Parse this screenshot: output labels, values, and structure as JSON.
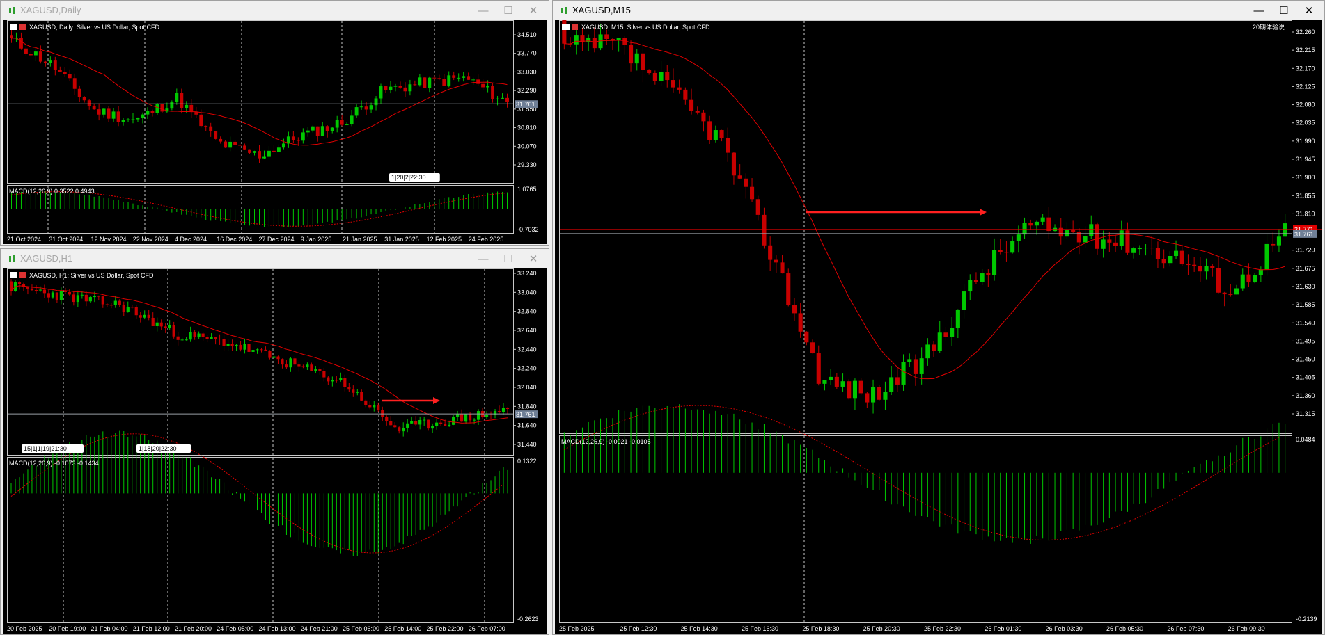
{
  "windows": {
    "daily": {
      "title": "XAGUSD,Daily",
      "header": "XAGUSD, Daily:  Silver vs US Dollar, Spot CFD",
      "macd_label": "MACD(12,26,9) 0.3522 0.4943",
      "price_labels": [
        "34.510",
        "33.770",
        "33.030",
        "32.290",
        "31.550",
        "30.810",
        "30.070",
        "29.330"
      ],
      "current_price": "31.761",
      "macd_labels": [
        "1.0765",
        "-0.7032"
      ],
      "time_labels": [
        "21 Oct 2024",
        "31 Oct 2024",
        "12 Nov 2024",
        "22 Nov 2024",
        "4 Dec 2024",
        "16 Dec 2024",
        "27 Dec 2024",
        "9 Jan 2025",
        "21 Jan 2025",
        "31 Jan 2025",
        "12 Feb 2025",
        "24 Feb 2025"
      ],
      "countdown": "1|20|2|22:30"
    },
    "h1": {
      "title": "XAGUSD,H1",
      "header": "XAGUSD, H1:  Silver vs US Dollar, Spot CFD",
      "macd_label": "MACD(12,26,9) -0.1073 -0.1434",
      "price_labels": [
        "33.240",
        "33.040",
        "32.840",
        "32.640",
        "32.440",
        "32.240",
        "32.040",
        "31.840",
        "31.640",
        "31.440"
      ],
      "current_price": "31.761",
      "macd_labels": [
        "0.1322",
        "-0.2623"
      ],
      "time_labels": [
        "20 Feb 2025",
        "20 Feb 19:00",
        "21 Feb 04:00",
        "21 Feb 12:00",
        "21 Feb 20:00",
        "24 Feb 05:00",
        "24 Feb 13:00",
        "24 Feb 21:00",
        "25 Feb 06:00",
        "25 Feb 14:00",
        "25 Feb 22:00",
        "26 Feb 07:00"
      ],
      "countdown_left": "15|1|1|19|21:30",
      "countdown_mid": "1|18|20|22:30"
    },
    "m15": {
      "title": "XAGUSD,M15",
      "header": "XAGUSD, M15:  Silver vs US Dollar, Spot CFD",
      "watermark": "20期体验说",
      "macd_label": "MACD(12,26,9) -0.0021 -0.0105",
      "price_labels": [
        "32.260",
        "32.215",
        "32.170",
        "32.125",
        "32.080",
        "32.035",
        "31.990",
        "31.945",
        "31.900",
        "31.855",
        "31.810",
        "31.765",
        "31.720",
        "31.675",
        "31.630",
        "31.585",
        "31.540",
        "31.495",
        "31.450",
        "31.405",
        "31.360",
        "31.315"
      ],
      "current_price": "31.761",
      "red_price": "31.771",
      "macd_labels": [
        "0.0484",
        "-0.2139"
      ],
      "time_labels": [
        "25 Feb 2025",
        "25 Feb 12:30",
        "25 Feb 14:30",
        "25 Feb 16:30",
        "25 Feb 18:30",
        "25 Feb 20:30",
        "25 Feb 22:30",
        "26 Feb 01:30",
        "26 Feb 03:30",
        "26 Feb 05:30",
        "26 Feb 07:30",
        "26 Feb 09:30"
      ]
    }
  },
  "colors": {
    "bull": "#00c800",
    "bear": "#c80000",
    "ma": "#e00000",
    "grid": "#c8c8c8",
    "bg": "#000000",
    "text": "#ffffff"
  },
  "icons": {
    "window": "chart-window-icon",
    "minimize": "minimize-icon",
    "maximize": "maximize-icon",
    "close": "close-icon"
  },
  "buttons": {
    "minimize": "—",
    "maximize": "☐",
    "close": "✕"
  }
}
